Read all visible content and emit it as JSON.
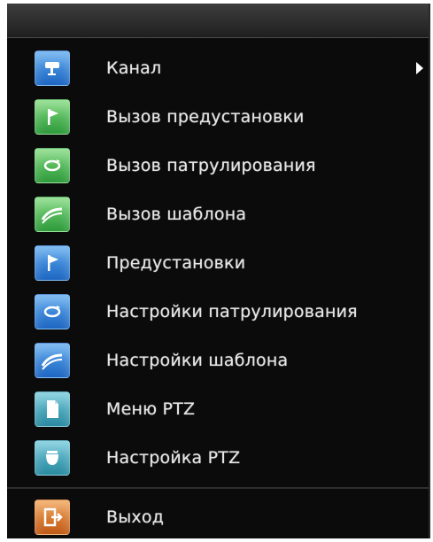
{
  "menu": {
    "items": [
      {
        "label": "Канал",
        "icon": "camera-icon",
        "color": "#3a86d8",
        "submenu": true
      },
      {
        "label": "Вызов предустановки",
        "icon": "flag-icon",
        "color": "#4ab85a"
      },
      {
        "label": "Вызов патрулирования",
        "icon": "cycle-icon",
        "color": "#4ab85a"
      },
      {
        "label": "Вызов шаблона",
        "icon": "track-icon",
        "color": "#4ab85a"
      },
      {
        "label": "Предустановки",
        "icon": "flag-icon",
        "color": "#3a86d8"
      },
      {
        "label": "Настройки патрулирования",
        "icon": "cycle-icon",
        "color": "#3a86d8"
      },
      {
        "label": "Настройки шаблона",
        "icon": "track-icon",
        "color": "#3a86d8"
      },
      {
        "label": "Меню PTZ",
        "icon": "document-icon",
        "color": "#4aa8bc"
      },
      {
        "label": "Настройка PTZ",
        "icon": "dome-camera-icon",
        "color": "#4aa8bc"
      }
    ],
    "exit": {
      "label": "Выход",
      "icon": "exit-icon",
      "color": "#e07a30"
    }
  }
}
